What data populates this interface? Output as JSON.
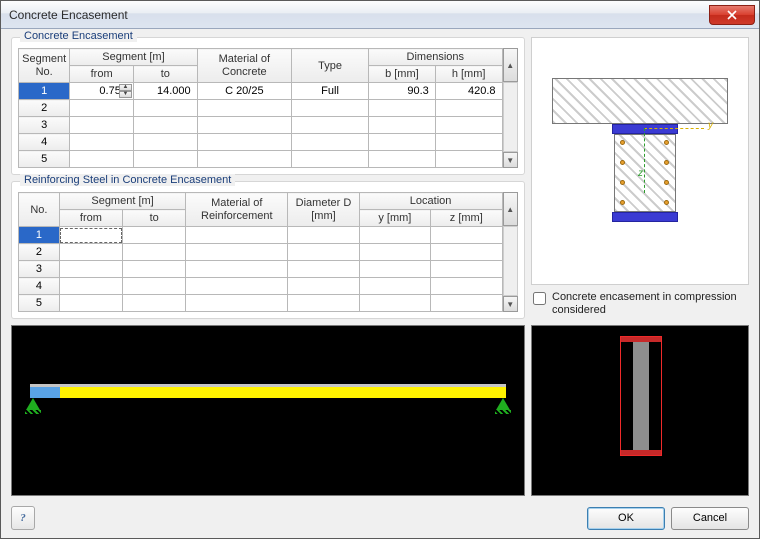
{
  "window": {
    "title": "Concrete Encasement"
  },
  "group1": {
    "title": "Concrete Encasement",
    "headers": {
      "segno": "Segment\nNo.",
      "segment": "Segment [m]",
      "from": "from",
      "to": "to",
      "material": "Material of\nConcrete",
      "type": "Type",
      "dimensions": "Dimensions",
      "b": "b [mm]",
      "h": "h [mm]"
    },
    "rows": [
      {
        "no": "1",
        "from": "0.750",
        "to": "14.000",
        "material": "C 20/25",
        "type": "Full",
        "b": "90.3",
        "h": "420.8"
      },
      {
        "no": "2",
        "from": "",
        "to": "",
        "material": "",
        "type": "",
        "b": "",
        "h": ""
      },
      {
        "no": "3",
        "from": "",
        "to": "",
        "material": "",
        "type": "",
        "b": "",
        "h": ""
      },
      {
        "no": "4",
        "from": "",
        "to": "",
        "material": "",
        "type": "",
        "b": "",
        "h": ""
      },
      {
        "no": "5",
        "from": "",
        "to": "",
        "material": "",
        "type": "",
        "b": "",
        "h": ""
      }
    ]
  },
  "group2": {
    "title": "Reinforcing Steel in Concrete Encasement",
    "headers": {
      "no": "No.",
      "segment": "Segment [m]",
      "from": "from",
      "to": "to",
      "material": "Material of\nReinforcement",
      "diameter": "Diameter\nD [mm]",
      "location": "Location",
      "y": "y [mm]",
      "z": "z [mm]"
    },
    "rows": [
      {
        "no": "1",
        "from": "",
        "to": "",
        "material": "",
        "d": "",
        "y": "",
        "z": ""
      },
      {
        "no": "2",
        "from": "",
        "to": "",
        "material": "",
        "d": "",
        "y": "",
        "z": ""
      },
      {
        "no": "3",
        "from": "",
        "to": "",
        "material": "",
        "d": "",
        "y": "",
        "z": ""
      },
      {
        "no": "4",
        "from": "",
        "to": "",
        "material": "",
        "d": "",
        "y": "",
        "z": ""
      },
      {
        "no": "5",
        "from": "",
        "to": "",
        "material": "",
        "d": "",
        "y": "",
        "z": ""
      }
    ]
  },
  "checkbox": {
    "label": "Concrete encasement in compression considered",
    "checked": false
  },
  "axes": {
    "y": "y",
    "z": "z"
  },
  "buttons": {
    "help": "?",
    "ok": "OK",
    "cancel": "Cancel"
  }
}
